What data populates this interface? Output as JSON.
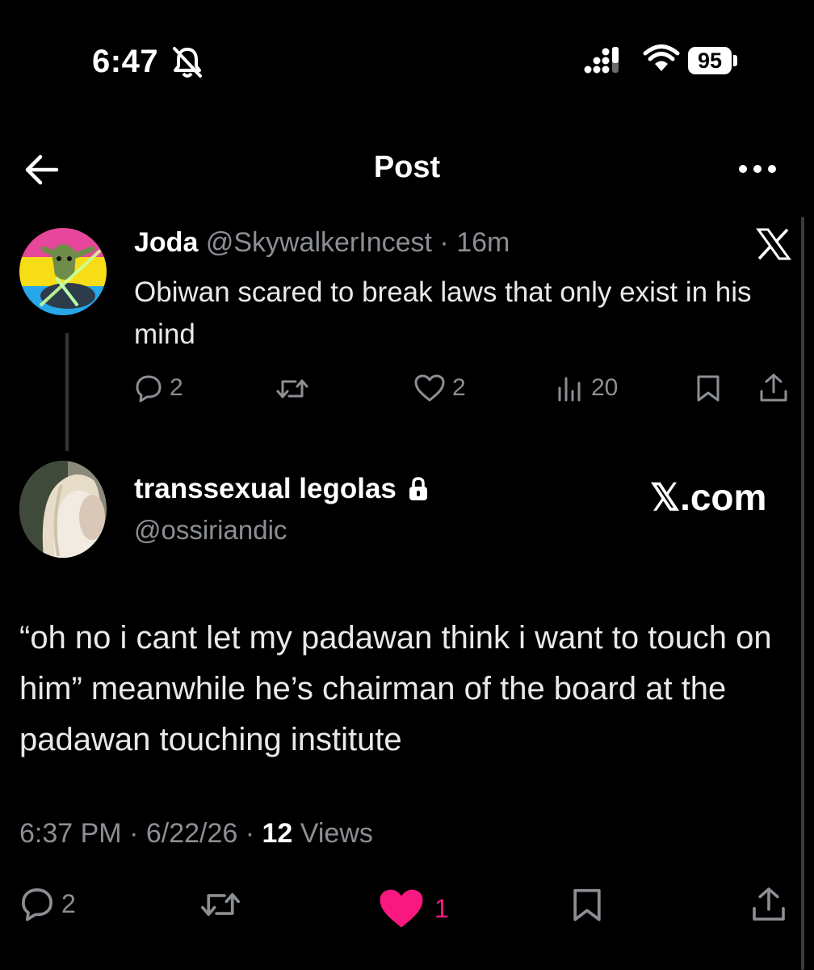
{
  "status_bar": {
    "time": "6:47",
    "battery": "95",
    "icons": [
      "bell-slash-icon",
      "signal-icon",
      "wifi-icon",
      "battery-icon"
    ]
  },
  "header": {
    "title": "Post",
    "back_icon": "arrow-left-icon",
    "more_icon": "more-horizontal-icon"
  },
  "parent_post": {
    "display_name": "Joda",
    "handle": "@SkywalkerIncest",
    "separator": " · ",
    "time": "16m",
    "text": "Obiwan scared to break laws that only exist in his mind",
    "actions": {
      "replies": "2",
      "likes": "2",
      "views": "20"
    }
  },
  "main_post": {
    "display_name": "transsexual legolas",
    "handle": "@ossiriandic",
    "watermark_symbol": "𝕏",
    "watermark_text": ".com",
    "text": "“oh no i cant let my padawan think i want to touch on him” meanwhile he’s chairman of the board at the padawan touching institute",
    "time": "6:37 PM",
    "sep1": " · ",
    "date": "6/22/26",
    "sep2": " · ",
    "views_count": "12",
    "views_label": " Views",
    "actions": {
      "replies": "2",
      "likes": "1"
    }
  },
  "colors": {
    "background": "#000000",
    "text": "#e7e9ea",
    "muted": "#8b8f94",
    "like_active": "#f91880"
  }
}
